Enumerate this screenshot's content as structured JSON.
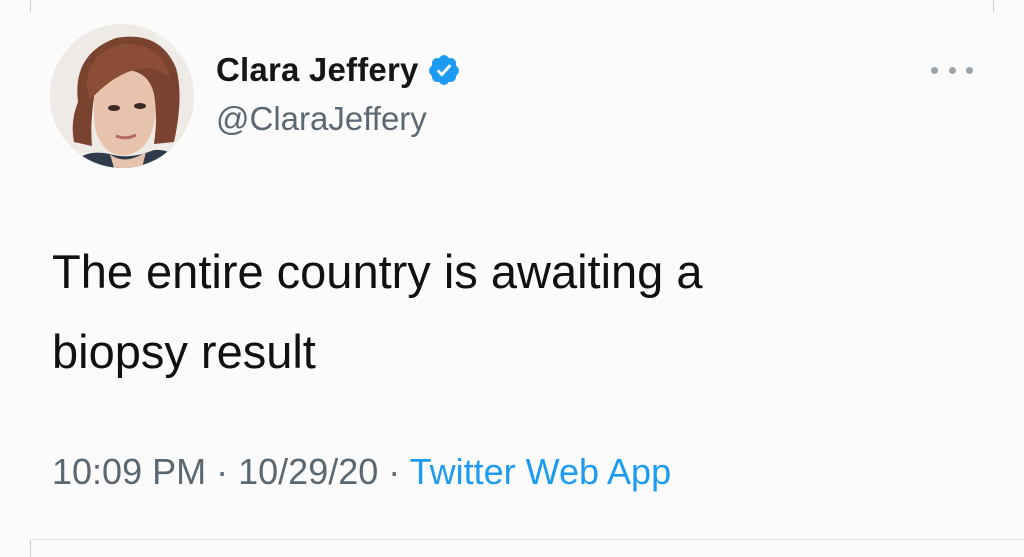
{
  "author": {
    "display_name": "Clara Jeffery",
    "handle": "@ClaraJeffery",
    "verified": true
  },
  "tweet": {
    "text_lines": [
      "The entire country is awaiting a",
      "biopsy result"
    ]
  },
  "meta": {
    "time": "10:09 PM",
    "separator": "·",
    "date": "10/29/20",
    "source": "Twitter Web App"
  },
  "icons": {
    "verified": "verified-badge-icon",
    "more": "more-options-icon"
  },
  "colors": {
    "verified_blue": "#1d9bf0",
    "link_blue": "#1d9bf0",
    "muted_gray": "#5b6771"
  }
}
